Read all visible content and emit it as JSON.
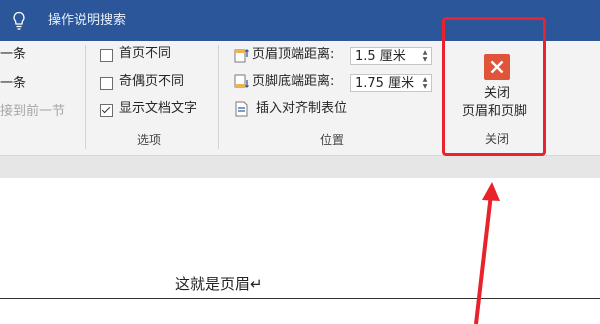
{
  "titlebar": {
    "search_label": "操作说明搜索"
  },
  "navigation_group": {
    "item1": "一条",
    "item2": "一条",
    "item3": "接到前一节"
  },
  "options_group": {
    "first_page_diff": {
      "label": "首页不同",
      "checked": false
    },
    "odd_even_diff": {
      "label": "奇偶页不同",
      "checked": false
    },
    "show_doc_text": {
      "label": "显示文档文字",
      "checked": true
    },
    "group_label": "选项"
  },
  "position_group": {
    "header_from_top": {
      "label": "页眉顶端距离:",
      "value": "1.5 厘米"
    },
    "footer_from_bottom": {
      "label": "页脚底端距离:",
      "value": "1.75 厘米"
    },
    "insert_align_tab": "插入对齐制表位",
    "group_label": "位置"
  },
  "close_group": {
    "button_line1": "关闭",
    "button_line2": "页眉和页脚",
    "group_label": "关闭"
  },
  "document": {
    "header_text": "这就是页眉↵"
  },
  "colors": {
    "titlebar": "#2b579a",
    "close_button": "#e0553a",
    "annotation": "#e8232b"
  }
}
